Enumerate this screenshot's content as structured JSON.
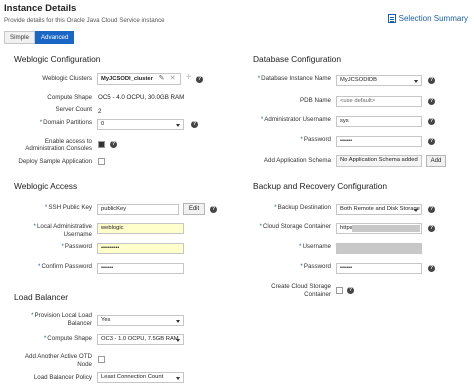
{
  "header": {
    "title": "Instance Details",
    "subtitle": "Provide details for this Oracle Java Cloud Service instance",
    "summary_link": "Selection Summary"
  },
  "tabs": [
    {
      "label": "Simple",
      "active": false
    },
    {
      "label": "Advanced",
      "active": true
    }
  ],
  "weblogic_config": {
    "heading": "Weblogic Configuration",
    "clusters_label": "Weblogic Clusters",
    "cluster_name": "MyJCSODI_cluster",
    "compute_shape_label": "Compute Shape",
    "compute_shape_value": "OC5 - 4.0 OCPU, 30.0GB RAM",
    "server_count_label": "Server Count",
    "server_count_value": "2",
    "domain_partitions_label": "Domain Partitions",
    "domain_partitions_value": "0",
    "admin_console_label_1": "Enable access to",
    "admin_console_label_2": "Administration Consoles",
    "admin_console_checked": true,
    "deploy_sample_label": "Deploy Sample Application",
    "deploy_sample_checked": false
  },
  "weblogic_access": {
    "heading": "Weblogic Access",
    "ssh_key_label": "SSH Public Key",
    "ssh_key_value": "publicKey",
    "ssh_edit_button": "Edit",
    "local_admin_label_1": "Local Administrative",
    "local_admin_label_2": "Username",
    "local_admin_value": "weblogic",
    "password_label": "Password",
    "password_value": "•••••••••",
    "confirm_password_label": "Confirm Password",
    "confirm_password_value": "••••••"
  },
  "load_balancer": {
    "heading": "Load Balancer",
    "provision_label_1": "Provision Local Load",
    "provision_label_2": "Balancer",
    "provision_value": "Yes",
    "compute_shape_label": "Compute Shape",
    "compute_shape_value": "OC3 - 1.0 OCPU, 7.5GB RAM",
    "another_otd_label_1": "Add Another Active OTD",
    "another_otd_label_2": "Node",
    "another_otd_checked": false,
    "policy_label": "Load Balancer Policy",
    "policy_value": "Least Connection Count"
  },
  "database_config": {
    "heading": "Database Configuration",
    "db_instance_label": "Database Instance Name",
    "db_instance_value": "MyJCSODIDB",
    "pdb_label": "PDB Name",
    "pdb_placeholder": "<use default>",
    "admin_user_label": "Administrator Username",
    "admin_user_value": "sys",
    "password_label": "Password",
    "password_value": "••••••",
    "add_schema_label": "Add Application Schema",
    "add_schema_value": "No Application Schema added",
    "add_button": "Add"
  },
  "backup_config": {
    "heading": "Backup and Recovery Configuration",
    "destination_label": "Backup Destination",
    "destination_value": "Both Remote and Disk Storage",
    "cloud_container_label": "Cloud Storage Container",
    "cloud_container_value": "https:/",
    "username_label": "Username",
    "password_label": "Password",
    "password_value": "••••••",
    "create_container_label_1": "Create Cloud Storage",
    "create_container_label_2": "Container",
    "create_container_checked": false
  },
  "colors": {
    "accent": "#1a66c4",
    "link": "#1a5fa8",
    "required_input_bg": "#ffffcc"
  }
}
